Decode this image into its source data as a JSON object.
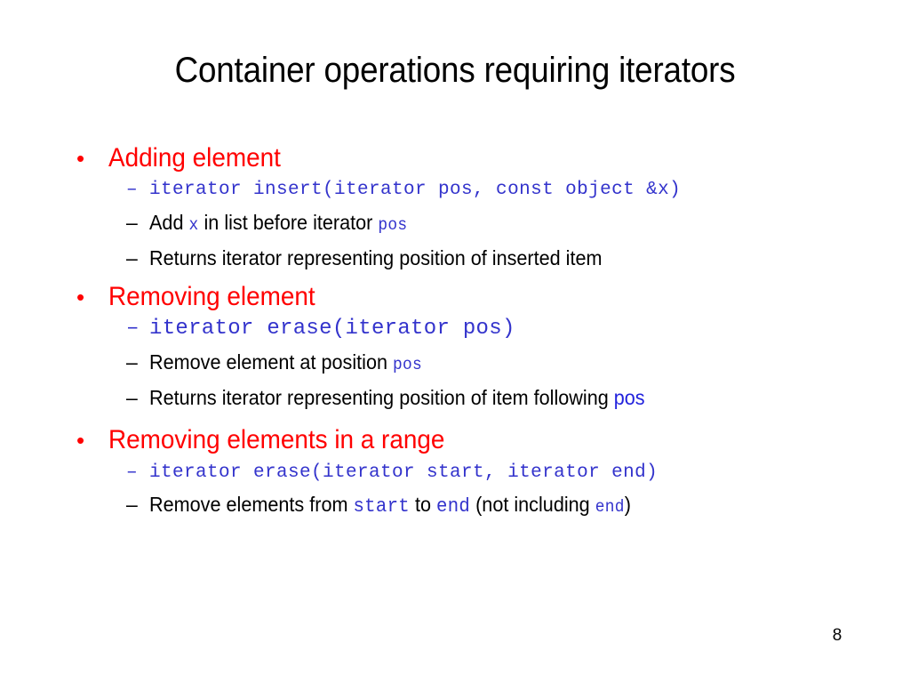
{
  "slide": {
    "title": "Container operations requiring iterators",
    "page_number": "8",
    "bullet_marker": "•",
    "sub_marker": "–",
    "colors": {
      "title": "#000000",
      "level1": "#FF0000",
      "code": "#3333CC",
      "prose": "#000000",
      "inline_highlight": "#2222DD",
      "background": "#FFFFFF"
    }
  },
  "sections": [
    {
      "heading": "Adding element",
      "lines": [
        {
          "kind": "code",
          "text": "iterator insert(iterator pos, const object &x)"
        },
        {
          "kind": "prose",
          "parts": [
            {
              "style": "plain",
              "text": "Add "
            },
            {
              "style": "mono",
              "text": "x"
            },
            {
              "style": "plain",
              "text": " in list before iterator "
            },
            {
              "style": "mono",
              "text": "pos"
            }
          ],
          "plain_text": "Add x in list before iterator pos"
        },
        {
          "kind": "prose",
          "parts": [
            {
              "style": "plain",
              "text": "Returns iterator representing position of inserted item"
            }
          ],
          "plain_text": "Returns iterator representing position of inserted item"
        }
      ]
    },
    {
      "heading": "Removing element",
      "lines": [
        {
          "kind": "code",
          "text": "iterator erase(iterator pos)"
        },
        {
          "kind": "prose",
          "parts": [
            {
              "style": "plain",
              "text": "Remove element at position "
            },
            {
              "style": "mono",
              "text": "pos"
            }
          ],
          "plain_text": "Remove element at position pos"
        },
        {
          "kind": "prose",
          "parts": [
            {
              "style": "plain",
              "text": "Returns iterator representing position of item following "
            },
            {
              "style": "sans-blue",
              "text": "pos"
            }
          ],
          "plain_text": "Returns iterator representing position of item following pos"
        }
      ]
    },
    {
      "heading": "Removing elements in a range",
      "lines": [
        {
          "kind": "code",
          "text": "iterator erase(iterator start, iterator end)"
        },
        {
          "kind": "prose",
          "parts": [
            {
              "style": "plain",
              "text": "Remove elements from "
            },
            {
              "style": "mono",
              "text": "start"
            },
            {
              "style": "plain",
              "text": " to "
            },
            {
              "style": "mono",
              "text": "end"
            },
            {
              "style": "plain",
              "text": " (not including "
            },
            {
              "style": "mono",
              "text": "end"
            },
            {
              "style": "plain",
              "text": ")"
            }
          ],
          "plain_text": "Remove elements from start to end (not including end)"
        }
      ]
    }
  ]
}
